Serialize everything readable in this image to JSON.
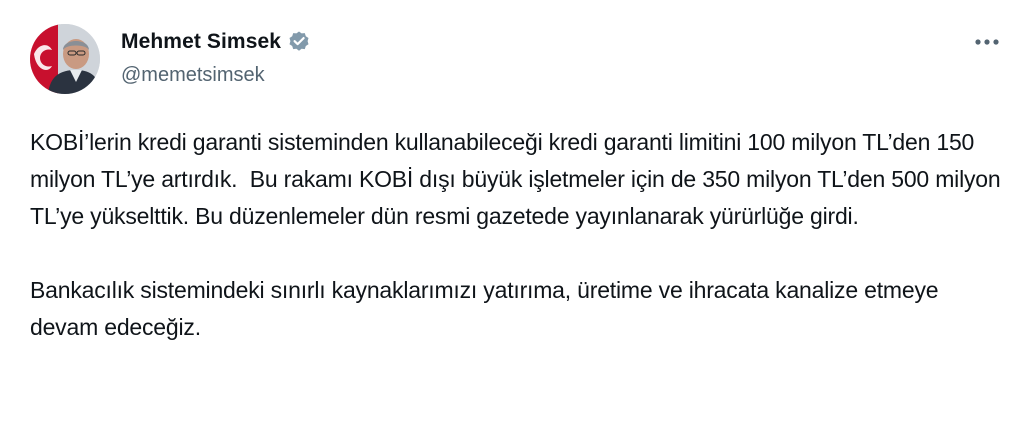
{
  "author": {
    "display_name": "Mehmet Simsek",
    "handle": "@memetsimsek",
    "verified_icon": "verified-badge-icon",
    "colors": {
      "verified": "#829aab",
      "handle": "#536471",
      "text": "#0f1419"
    }
  },
  "menu": {
    "icon": "more-horizontal-icon",
    "label": "..."
  },
  "tweet": {
    "paragraphs": [
      "KOBİ’lerin kredi garanti sisteminden kullanabileceği kredi garanti limitini 100 milyon TL’den 150 milyon TL’ye artırdık.  Bu rakamı KOBİ dışı büyük işletmeler için de 350 milyon TL’den 500 milyon TL’ye yükselttik. Bu düzenlemeler dün resmi gazetede yayınlanarak yürürlüğe girdi.",
      "Bankacılık sistemindeki sınırlı kaynaklarımızı yatırıma, üretime ve ihracata kanalize etmeye devam edeceğiz."
    ]
  }
}
